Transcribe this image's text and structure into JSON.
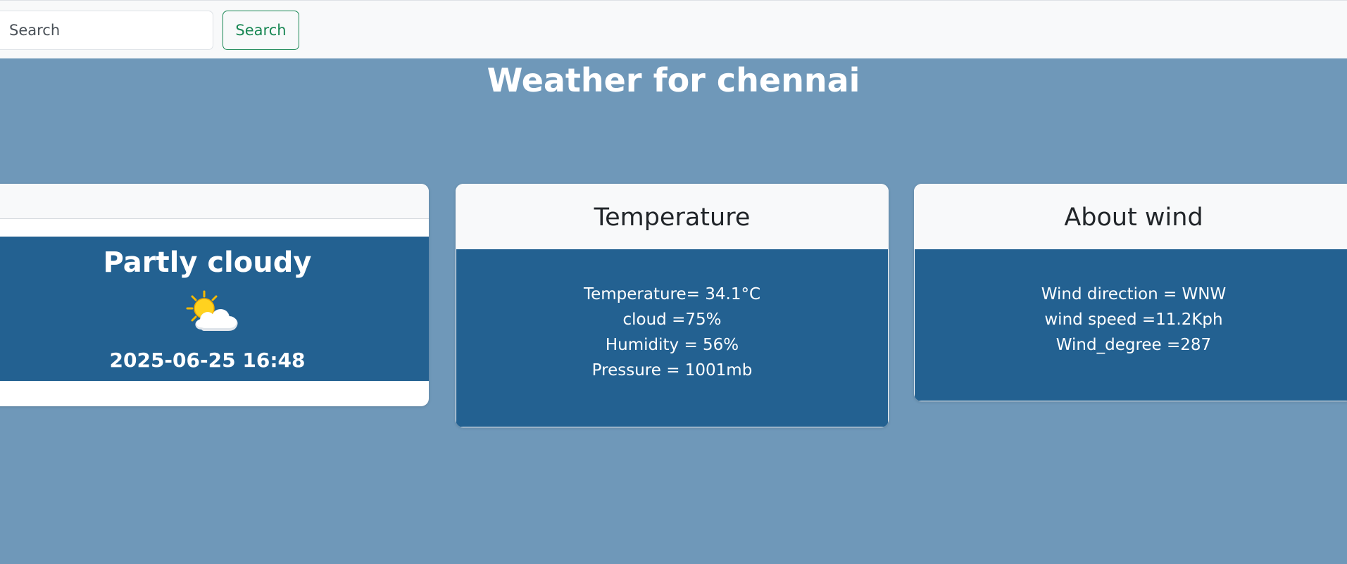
{
  "search": {
    "placeholder": "Search",
    "button_label": "Search"
  },
  "page": {
    "title": "Weather for chennai"
  },
  "condition_card": {
    "condition": "Partly cloudy",
    "icon": "partly-cloudy-icon",
    "localtime": "2025-06-25 16:48"
  },
  "temperature_card": {
    "title": "Temperature",
    "temperature": "Temperature= 34.1°C",
    "cloud": "cloud =75%",
    "humidity": "Humidity = 56%",
    "pressure": "Pressure = 1001mb"
  },
  "wind_card": {
    "title": "About wind",
    "direction": "Wind direction = WNW",
    "speed": "wind speed =11.2Kph",
    "degree": "Wind_degree =287"
  },
  "colors": {
    "page_background": "#6f98b9",
    "card_body": "#236191",
    "navbar": "#f8f9fa",
    "search_button_accent": "#198754"
  }
}
